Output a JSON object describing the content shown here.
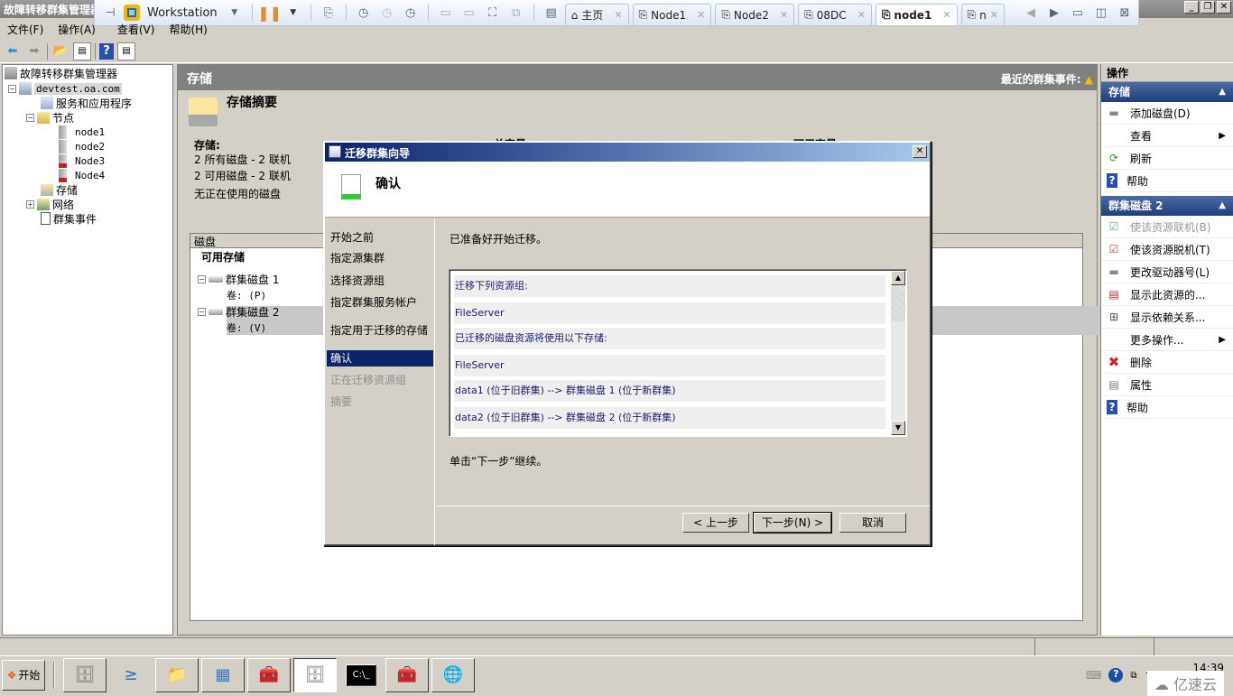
{
  "window": {
    "title": "故障转移群集管理器"
  },
  "vmware": {
    "product": "Workstation",
    "tabs": [
      {
        "label": "主页",
        "icon": "home-icon"
      },
      {
        "label": "Node1",
        "icon": "vm-icon"
      },
      {
        "label": "Node2",
        "icon": "vm-icon"
      },
      {
        "label": "08DC",
        "icon": "vm-icon"
      },
      {
        "label": "node1",
        "icon": "vm-icon",
        "active": true
      },
      {
        "label": "n",
        "icon": "vm-icon"
      }
    ]
  },
  "menu": [
    "文件(F)",
    "操作(A)",
    "查看(V)",
    "帮助(H)"
  ],
  "tree": {
    "root": "故障转移群集管理器",
    "cluster": "devtest.oa.com",
    "items": {
      "services": "服务和应用程序",
      "nodes": "节点",
      "node_list": [
        "node1",
        "node2",
        "Node3",
        "Node4"
      ],
      "storage": "存储",
      "network": "网络",
      "events": "群集事件"
    }
  },
  "center": {
    "title": "存储",
    "recent_events": "最近的群集事件:",
    "summary_title": "存储摘要",
    "storage_label": "存储:",
    "lines": [
      "2 所有磁盘 - 2 联机",
      "2 可用磁盘 - 2 联机",
      "无正在使用的磁盘"
    ],
    "col_total": "总容量",
    "col_available": "可用容量",
    "disk_header": "磁盘",
    "group": "可用存储",
    "disks": [
      {
        "name": "群集磁盘 1",
        "volume": "卷: (P)"
      },
      {
        "name": "群集磁盘 2",
        "volume": "卷: (V)",
        "selected": true
      }
    ]
  },
  "actions": {
    "title": "操作",
    "sections": [
      {
        "title": "存储",
        "items": [
          {
            "label": "添加磁盘(D)",
            "icon": "add-disk-icon"
          },
          {
            "label": "查看",
            "icon": "",
            "submenu": true
          },
          {
            "label": "刷新",
            "icon": "refresh-icon"
          },
          {
            "label": "帮助",
            "icon": "help-icon"
          }
        ]
      },
      {
        "title": "群集磁盘 2",
        "items": [
          {
            "label": "使该资源联机(B)",
            "icon": "bring-online-icon",
            "disabled": true
          },
          {
            "label": "使该资源脱机(T)",
            "icon": "take-offline-icon"
          },
          {
            "label": "更改驱动器号(L)",
            "icon": "drive-icon"
          },
          {
            "label": "显示此资源的...",
            "icon": "report-icon"
          },
          {
            "label": "显示依赖关系...",
            "icon": "dependency-icon"
          },
          {
            "label": "更多操作...",
            "icon": "",
            "submenu": true
          },
          {
            "label": "删除",
            "icon": "delete-icon"
          },
          {
            "label": "属性",
            "icon": "properties-icon"
          },
          {
            "label": "帮助",
            "icon": "help-icon"
          }
        ]
      }
    ]
  },
  "dialog": {
    "title": "迁移群集向导",
    "header": "确认",
    "steps": [
      {
        "label": "开始之前"
      },
      {
        "label": "指定源集群"
      },
      {
        "label": "选择资源组"
      },
      {
        "label": "指定群集服务帐户"
      },
      {
        "label": "指定用于迁移的存储"
      },
      {
        "label": "确认",
        "current": true
      },
      {
        "label": "正在迁移资源组",
        "disabled": true
      },
      {
        "label": "摘要",
        "disabled": true
      }
    ],
    "ready_text": "已准备好开始迁移。",
    "summary_rows": [
      "迁移下列资源组:",
      "FileServer",
      "已迁移的磁盘资源将使用以下存储:",
      "FileServer",
      "data1 (位于旧群集) --> 群集磁盘 1 (位于新群集)",
      "data2 (位于旧群集) --> 群集磁盘 2 (位于新群集)"
    ],
    "continue_text": "单击“下一步”继续。",
    "buttons": {
      "back": "< 上一步",
      "next": "下一步(N) >",
      "cancel": "取消"
    }
  },
  "taskbar": {
    "start": "开始",
    "apps": [
      "server-manager-icon",
      "powershell-icon",
      "explorer-icon",
      "control-panel-icon",
      "toolbox-icon",
      "cluster-manager-icon",
      "cmd-icon",
      "toolbox-icon",
      "network-icon"
    ],
    "clock": "14:39",
    "watermark": "亿速云"
  }
}
